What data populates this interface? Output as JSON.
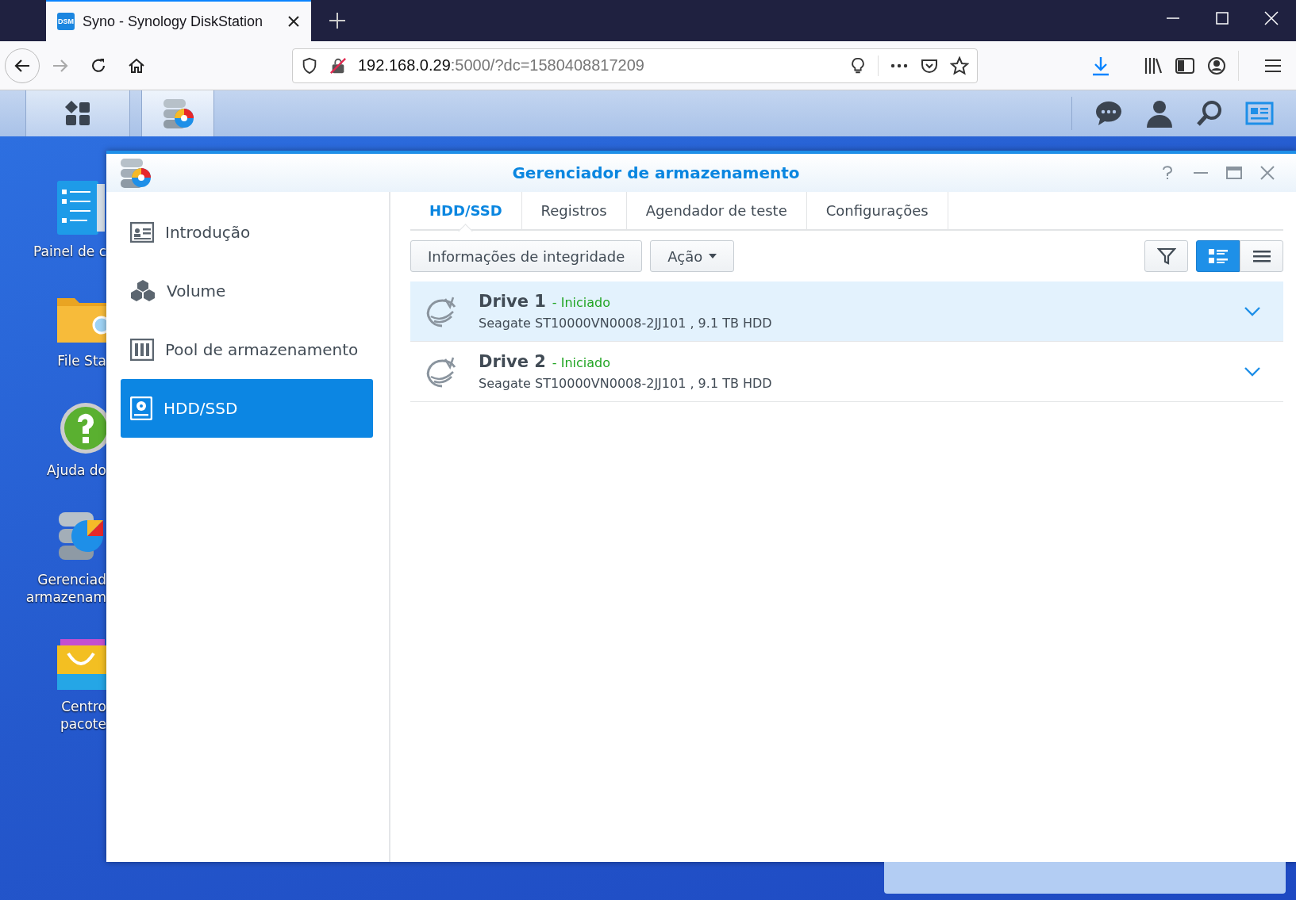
{
  "browser": {
    "tab": {
      "favicon_text": "DSM",
      "title": "Syno - Synology DiskStation",
      "selected": true
    },
    "address": {
      "host": "192.168.0.29",
      "rest": ":5000/?dc=1580408817209"
    }
  },
  "taskbar": {
    "apps": [
      {
        "kind": "main-menu",
        "selected": false
      },
      {
        "kind": "storage",
        "selected": true
      }
    ]
  },
  "desktop_icons": [
    {
      "kind": "control-panel",
      "lines": [
        "Painel de c"
      ]
    },
    {
      "kind": "folder",
      "lines": [
        "File Sta"
      ]
    },
    {
      "kind": "help",
      "lines": [
        "Ajuda do"
      ]
    },
    {
      "kind": "storage",
      "lines": [
        "Gerenciad",
        "armazenam"
      ]
    },
    {
      "kind": "package",
      "lines": [
        "Centro",
        "pacote"
      ]
    }
  ],
  "window": {
    "title": "Gerenciador de armazenamento",
    "sidebar": [
      {
        "kind": "overview",
        "label": "Introdução",
        "selected": false
      },
      {
        "kind": "volume",
        "label": "Volume",
        "selected": false
      },
      {
        "kind": "pool",
        "label": "Pool de armazenamento",
        "selected": false
      },
      {
        "kind": "disk",
        "label": "HDD/SSD",
        "selected": true
      }
    ],
    "tabs": [
      {
        "label": "HDD/SSD",
        "selected": true
      },
      {
        "label": "Registros",
        "selected": false
      },
      {
        "label": "Agendador de teste",
        "selected": false
      },
      {
        "label": "Configurações",
        "selected": false
      }
    ],
    "toolbar": {
      "buttons": [
        {
          "label": "Informações de integridade",
          "kind": "plain"
        },
        {
          "label": "Ação",
          "kind": "menu"
        }
      ],
      "views": [
        {
          "kind": "list",
          "selected": true
        },
        {
          "kind": "compact",
          "selected": false
        }
      ]
    },
    "drives": [
      {
        "name": "Drive 1",
        "status": "- Iniciado",
        "description": "Seagate ST10000VN0008-2JJ101 , 9.1 TB HDD",
        "selected": true
      },
      {
        "name": "Drive 2",
        "status": "- Iniciado",
        "description": "Seagate ST10000VN0008-2JJ101 , 9.1 TB HDD",
        "selected": false
      }
    ]
  }
}
